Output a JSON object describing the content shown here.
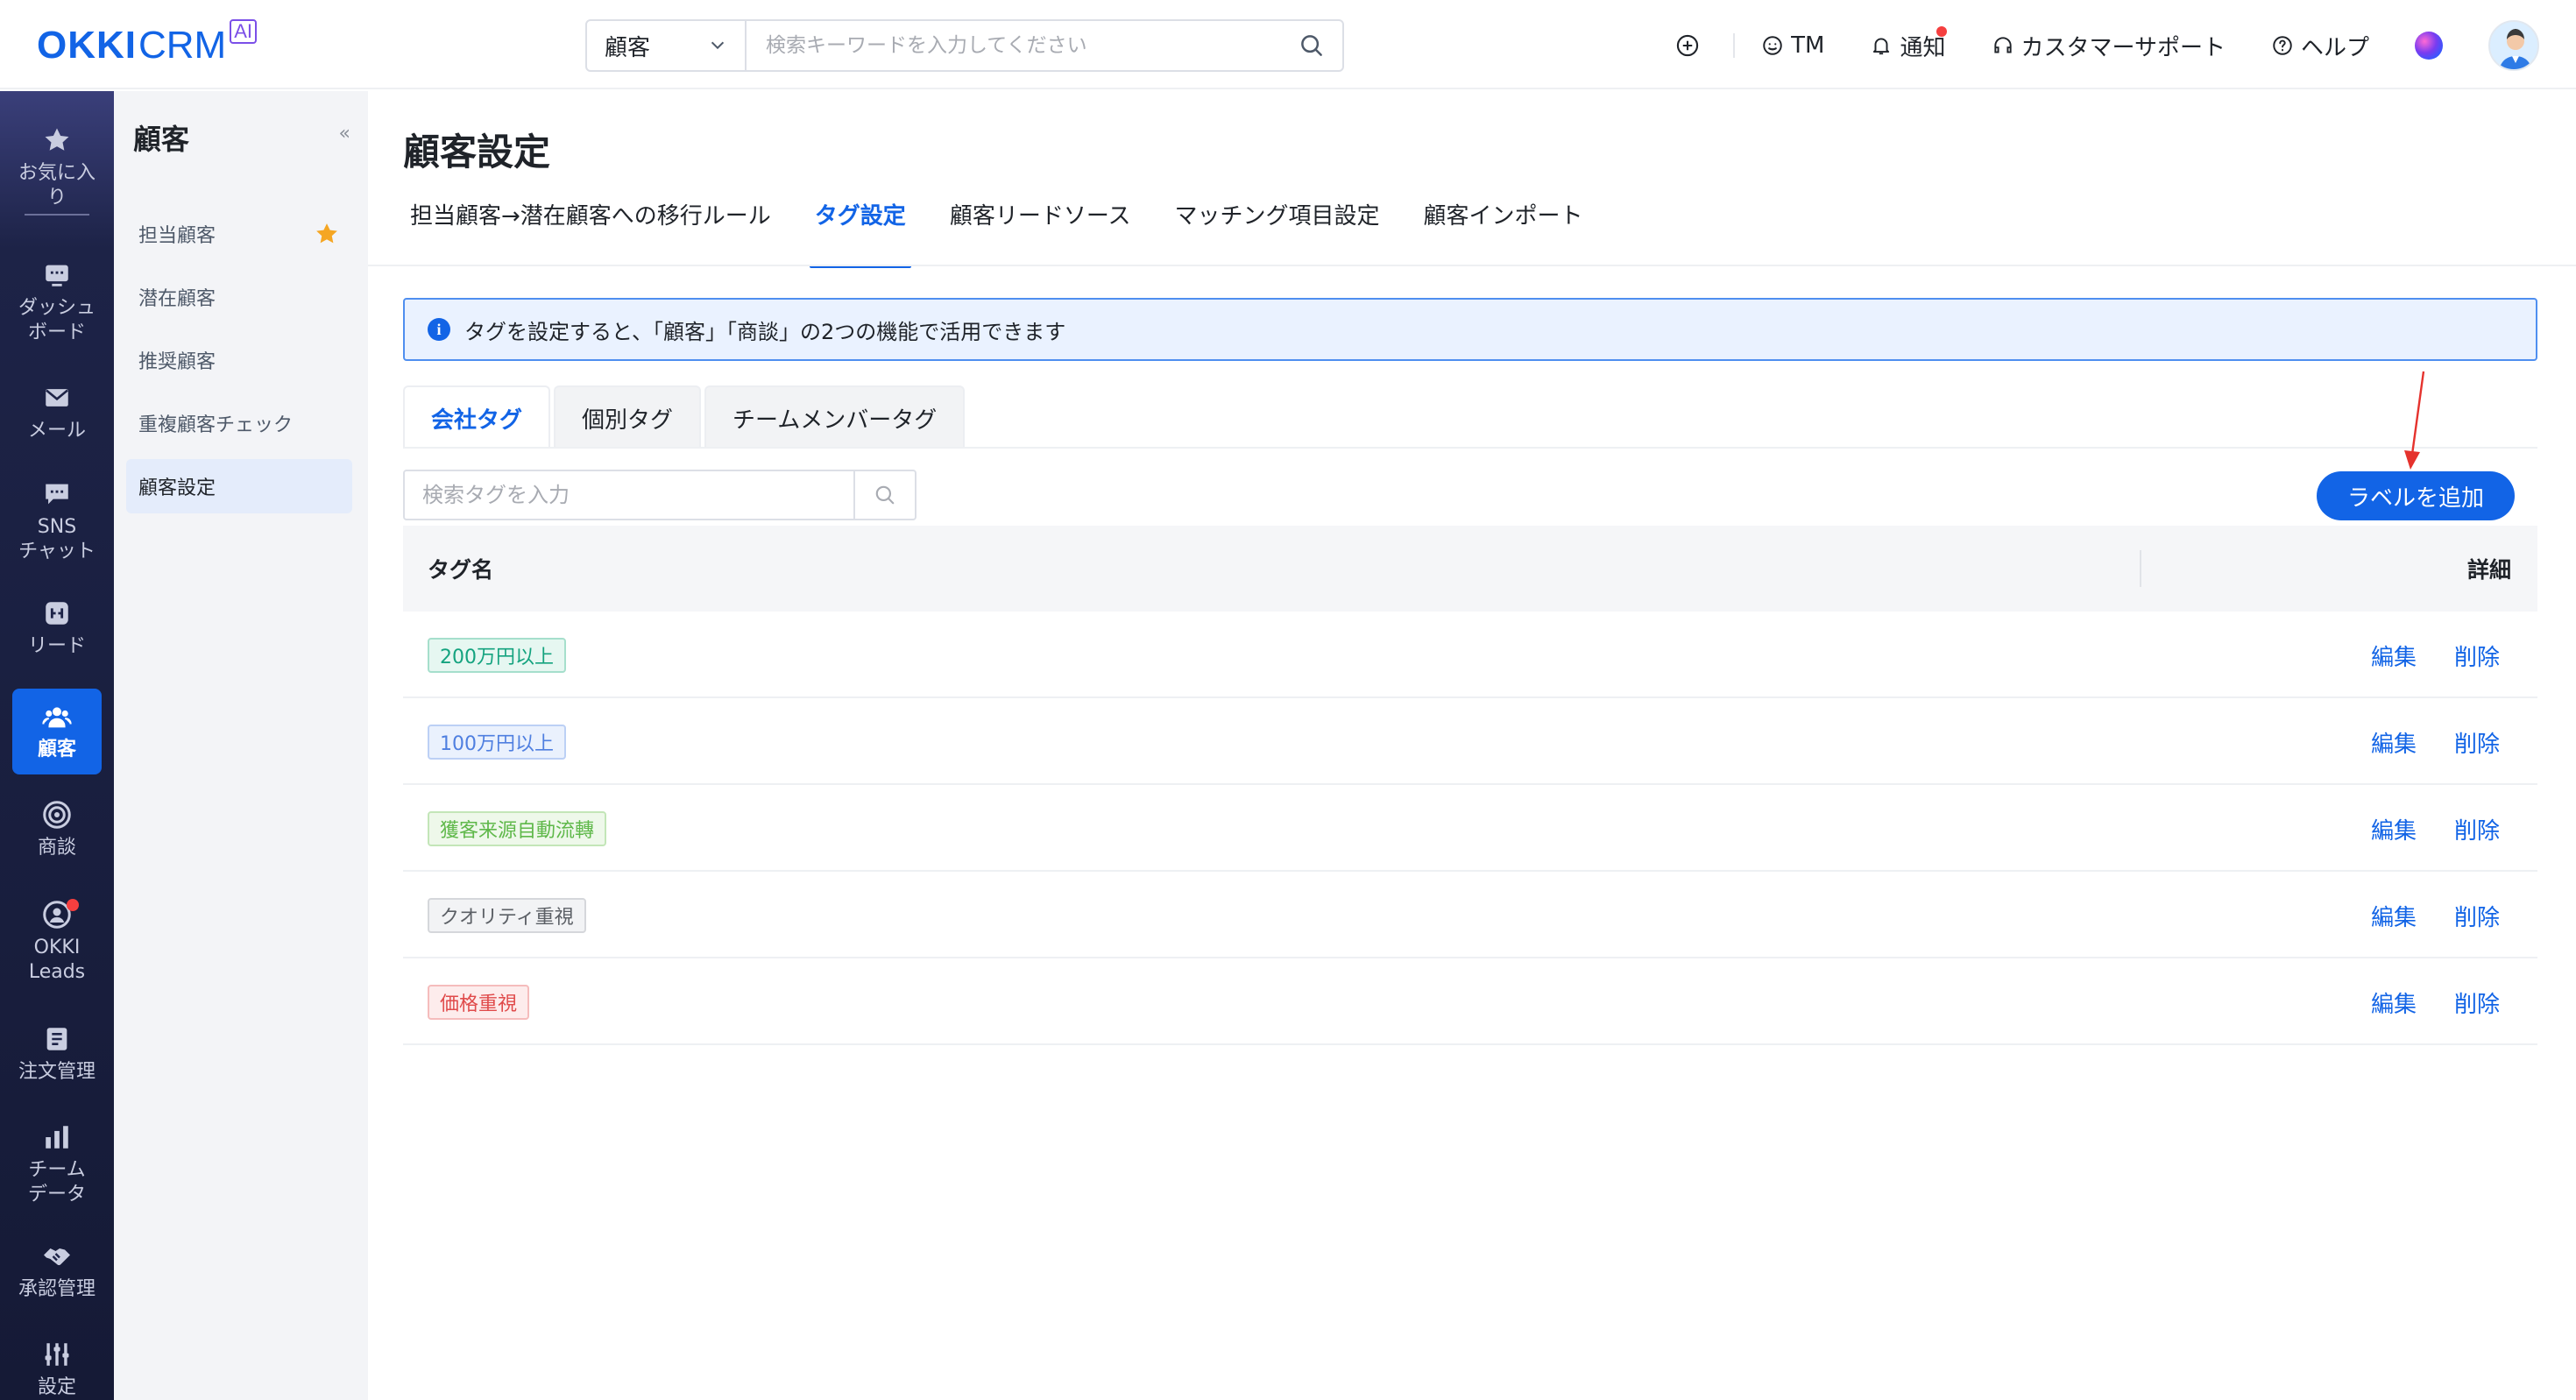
{
  "brand": {
    "name_bold": "OKKI",
    "name_light": "CRM",
    "badge": "AI",
    "color": "#1264e6"
  },
  "topbar": {
    "search_scope": "顧客",
    "search_placeholder": "検索キーワードを入力してください",
    "actions": {
      "add_icon": "plus-circle-icon",
      "tm": "TM",
      "notify": "通知",
      "support": "カスタマーサポート",
      "help": "ヘルプ"
    }
  },
  "leftnav": {
    "items": [
      {
        "label": "お気に入り",
        "icon": "star-icon"
      },
      {
        "label": "ダッシュボード",
        "icon": "dashboard-icon"
      },
      {
        "label": "メール",
        "icon": "mail-icon"
      },
      {
        "label": "SNSチャット",
        "icon": "chat-icon"
      },
      {
        "label": "リード",
        "icon": "lead-icon"
      },
      {
        "label": "顧客",
        "icon": "customer-icon"
      },
      {
        "label": "商談",
        "icon": "target-icon"
      },
      {
        "label": "OKKILeads",
        "icon": "okki-leads-icon"
      },
      {
        "label": "注文管理",
        "icon": "order-icon"
      },
      {
        "label": "チームデータ",
        "icon": "bar-chart-icon"
      },
      {
        "label": "承認管理",
        "icon": "handshake-icon"
      },
      {
        "label": "設定",
        "icon": "settings-sliders-icon"
      }
    ],
    "lines": {
      "fav": [
        "お気に入",
        "り"
      ],
      "dash": [
        "ダッシュ",
        "ボード"
      ],
      "sns": [
        "SNS",
        "チャット"
      ],
      "leads": [
        "OKKI",
        "Leads"
      ],
      "team": [
        "チーム",
        "データ"
      ]
    }
  },
  "subnav": {
    "title": "顧客",
    "collapse": "«",
    "items": [
      {
        "label": "担当顧客"
      },
      {
        "label": "潜在顧客"
      },
      {
        "label": "推奨顧客"
      },
      {
        "label": "重複顧客チェック"
      },
      {
        "label": "顧客設定"
      }
    ]
  },
  "main": {
    "title": "顧客設定",
    "tabs": [
      {
        "label": "担当顧客→潜在顧客への移行ルール"
      },
      {
        "label": "タグ設定"
      },
      {
        "label": "顧客リードソース"
      },
      {
        "label": "マッチング項目設定"
      },
      {
        "label": "顧客インポート"
      }
    ],
    "info": "タグを設定すると、「顧客」「商談」の2つの機能で活用できます",
    "subtabs": [
      {
        "label": "会社タグ"
      },
      {
        "label": "個別タグ"
      },
      {
        "label": "チームメンバータグ"
      }
    ],
    "tag_search_placeholder": "検索タグを入力",
    "add_button": "ラベルを追加",
    "table": {
      "col_name": "タグ名",
      "col_detail": "詳細",
      "edit": "編集",
      "delete": "削除",
      "rows": [
        {
          "name": "200万円以上",
          "color": "#14a37f",
          "bg": "#e6f7f1",
          "border": "#a6dfcc"
        },
        {
          "name": "100万円以上",
          "color": "#4f7fe0",
          "bg": "#eaf1fd",
          "border": "#bcd0f5"
        },
        {
          "name": "獲客来源自動流轉",
          "color": "#5fb84a",
          "bg": "#eef8ea",
          "border": "#c3e6b8"
        },
        {
          "name": "クオリティ重視",
          "color": "#5c6066",
          "bg": "#f2f3f5",
          "border": "#d5d7db"
        },
        {
          "name": "価格重視",
          "color": "#e04b4b",
          "bg": "#fdecec",
          "border": "#f5bcbc"
        }
      ]
    }
  }
}
